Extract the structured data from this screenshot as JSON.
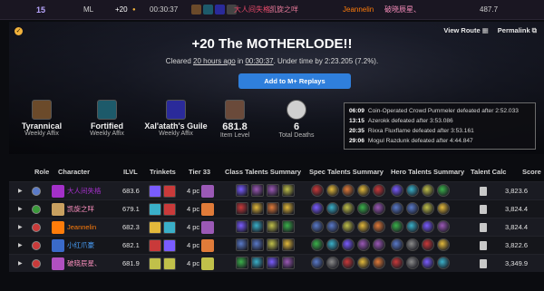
{
  "top": {
    "key_level": "15",
    "region": "ML",
    "upgrade": "+20",
    "star": "●",
    "time": "00:30:37",
    "names": [
      "大人间失格",
      "凯旋之咩",
      "Jeannelin",
      "破晓辰星、"
    ],
    "score": "487.7"
  },
  "hero": {
    "badge": "✓",
    "view_route": "View Route",
    "permalink": "Permalink",
    "title": "+20 The MOTHERLODE!!",
    "cleared_prefix": "Cleared",
    "cleared_ago": "20 hours ago",
    "cleared_in": "in",
    "cleared_time": "00:30:37",
    "cleared_suffix": ". Under time by 2:23.205 (7.2%).",
    "replay_button": "Add to M+ Replays",
    "affixes": [
      {
        "name": "Tyrannical",
        "sub": "Weekly Affix",
        "color": "#6b4a2a"
      },
      {
        "name": "Fortified",
        "sub": "Weekly Affix",
        "color": "#1d5a6a"
      },
      {
        "name": "Xal'atath's Guile",
        "sub": "Weekly Affix",
        "color": "#2a2a9a"
      },
      {
        "name": "681.8",
        "sub": "Item Level",
        "color": "#6a4a3a"
      },
      {
        "name": "6",
        "sub": "Total Deaths",
        "color": "#cfcfcf"
      }
    ],
    "timeline": [
      {
        "t": "06:09",
        "e": "Coin-Operated Crowd Pummeler defeated after 2:52.033"
      },
      {
        "t": "13:15",
        "e": "Azerokk defeated after 3:53.086"
      },
      {
        "t": "20:35",
        "e": "Rixxa Fluxflame defeated after 3:53.161"
      },
      {
        "t": "29:06",
        "e": "Mogul Razdunk defeated after 4:44.847"
      }
    ]
  },
  "table": {
    "headers": [
      "Role",
      "Character",
      "ILVL",
      "Trinkets",
      "Tier 33",
      "Class Talents Summary",
      "Spec Talents Summary",
      "Hero Talents Summary",
      "Talent Calc",
      "Score"
    ],
    "rows": [
      {
        "name": "大人间失格",
        "name_color": "#a330c9",
        "ilvl": "683.6",
        "tier": "4 pc",
        "score": "3,823.6",
        "role_color": "#5a7ac9",
        "class_color": "#a330c9"
      },
      {
        "name": "凯旋之咩",
        "name_color": "#f58cba",
        "ilvl": "679.1",
        "tier": "4 pc",
        "score": "3,824.4",
        "role_color": "#3a9a3a",
        "class_color": "#c8a060"
      },
      {
        "name": "Jeannelin",
        "name_color": "#ff7c0a",
        "ilvl": "682.3",
        "tier": "4 pc",
        "score": "3,824.4",
        "role_color": "#c93a3a",
        "class_color": "#ff7c0a"
      },
      {
        "name": "小红爪豪",
        "name_color": "#4aa3ff",
        "ilvl": "682.1",
        "tier": "4 pc",
        "score": "3,822.6",
        "role_color": "#c93a3a",
        "class_color": "#3a6ac9"
      },
      {
        "name": "破晓辰星、",
        "name_color": "#f58cba",
        "ilvl": "681.9",
        "tier": "4 pc",
        "score": "3,349.9",
        "role_color": "#c93a3a",
        "class_color": "#b050c0"
      }
    ]
  }
}
